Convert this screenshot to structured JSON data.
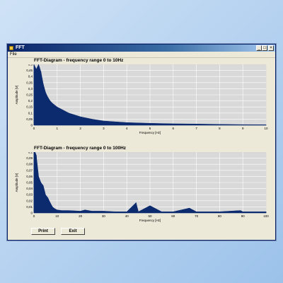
{
  "window": {
    "title": "FFT"
  },
  "menu": {
    "items": [
      "File"
    ]
  },
  "buttons": {
    "print": "Print",
    "exit": "Exit"
  },
  "colors": {
    "plot_bg": "#d9d9d9",
    "series": "#0c2a6e",
    "grid": "#ffffff",
    "titlebar": "#0a246a"
  },
  "chart_data": [
    {
      "type": "area",
      "title": "FFT-Diagram - frequency range 0 to 10Hz",
      "xlabel": "Frequency [Hz]",
      "ylabel": "Amplitude [V]",
      "xlim": [
        0,
        10
      ],
      "ylim": [
        0,
        0.5
      ],
      "x_ticks": [
        "0",
        "1",
        "2",
        "3",
        "4",
        "5",
        "6",
        "7",
        "8",
        "9",
        "10"
      ],
      "y_ticks": [
        "0",
        "0,05",
        "0,1",
        "0,15",
        "0,2",
        "0,25",
        "0,3",
        "0,35",
        "0,4",
        "0,45",
        "0,5"
      ],
      "x": [
        0,
        0.1,
        0.2,
        0.3,
        0.4,
        0.5,
        0.6,
        0.7,
        0.8,
        1.0,
        1.2,
        1.5,
        2.0,
        2.5,
        3.0,
        4.0,
        5.0,
        6.0,
        7.0,
        8.0,
        9.0,
        10.0
      ],
      "values": [
        0.5,
        0.46,
        0.5,
        0.44,
        0.34,
        0.27,
        0.23,
        0.2,
        0.18,
        0.15,
        0.13,
        0.1,
        0.07,
        0.05,
        0.035,
        0.022,
        0.016,
        0.012,
        0.01,
        0.007,
        0.005,
        0.004
      ],
      "grid": true
    },
    {
      "type": "area",
      "title": "FFT-Diagram - frequency range 0 to 100Hz",
      "xlabel": "Frequency [Hz]",
      "ylabel": "Amplitude [V]",
      "xlim": [
        0,
        100
      ],
      "ylim": [
        0,
        0.1
      ],
      "x_ticks": [
        "0",
        "10",
        "20",
        "30",
        "40",
        "50",
        "60",
        "70",
        "80",
        "90",
        "100"
      ],
      "y_ticks": [
        "0",
        "0,01",
        "0,02",
        "0,03",
        "0,04",
        "0,05",
        "0,06",
        "0,07",
        "0,08",
        "0,09",
        "0,1"
      ],
      "x": [
        0,
        0.5,
        1,
        2,
        3,
        4,
        5,
        6,
        7,
        8,
        9,
        10,
        12,
        15,
        20,
        22,
        25,
        30,
        35,
        40,
        44,
        45,
        50,
        55,
        60,
        67,
        70,
        80,
        89,
        90,
        100
      ],
      "values": [
        0.1,
        0.1,
        0.095,
        0.06,
        0.05,
        0.045,
        0.03,
        0.025,
        0.017,
        0.01,
        0.007,
        0.005,
        0.004,
        0.004,
        0.003,
        0.005,
        0.003,
        0.003,
        0.002,
        0.002,
        0.017,
        0.002,
        0.012,
        0.002,
        0.002,
        0.008,
        0.002,
        0.002,
        0.004,
        0.002,
        0.002
      ],
      "grid": true
    }
  ]
}
